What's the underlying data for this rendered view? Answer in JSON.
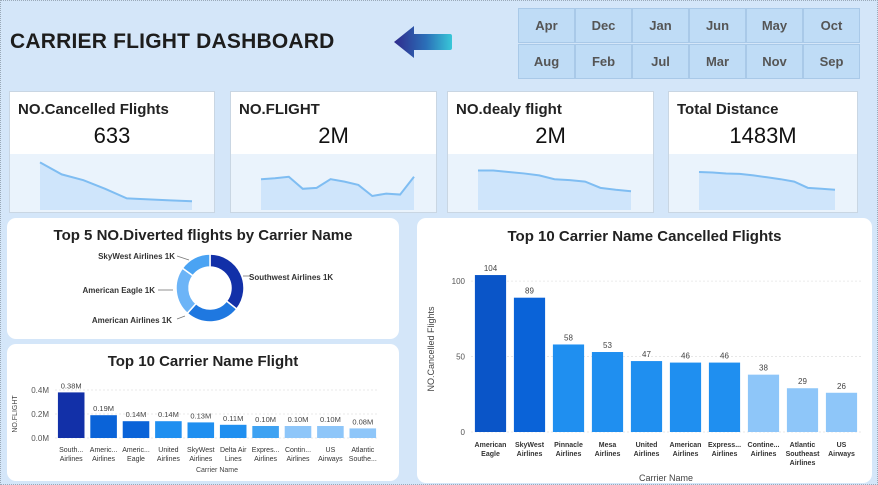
{
  "header": {
    "title": "CARRIER FLIGHT DASHBOARD"
  },
  "months": [
    "Apr",
    "Dec",
    "Jan",
    "Jun",
    "May",
    "Oct",
    "Aug",
    "Feb",
    "Jul",
    "Mar",
    "Nov",
    "Sep"
  ],
  "kpis": [
    {
      "label": "NO.Cancelled Flights",
      "value": "633",
      "trend": [
        95,
        70,
        58,
        40,
        20,
        18,
        16,
        14
      ]
    },
    {
      "label": "NO.FLIGHT",
      "value": "2M",
      "trend": [
        60,
        62,
        65,
        40,
        42,
        60,
        55,
        48,
        25,
        30,
        28,
        65
      ]
    },
    {
      "label": "NO.dealy flight",
      "value": "2M",
      "trend": [
        78,
        78,
        75,
        72,
        68,
        60,
        58,
        55,
        42,
        38,
        35
      ]
    },
    {
      "label": "Total Distance",
      "value": "1483M",
      "trend": [
        75,
        74,
        72,
        71,
        68,
        64,
        60,
        55,
        42,
        40,
        38
      ]
    }
  ],
  "colors": {
    "dark": "#1230a8",
    "mid": "#0a63d8",
    "bright": "#1f8ff0",
    "light": "#6cb4f7",
    "pale": "#8ec6f9"
  },
  "chart_data": [
    {
      "type": "pie",
      "title": "Top 5 NO.Diverted flights by Carrier Name",
      "slices": [
        {
          "label": "Southwest Airlines 1K",
          "value": 1.3,
          "color": "#1230a8"
        },
        {
          "label": "American Airlines 1K",
          "value": 0.95,
          "color": "#1f78e0"
        },
        {
          "label": "American Eagle 1K",
          "value": 0.85,
          "color": "#6cb4f7"
        },
        {
          "label": "SkyWest Airlines 1K",
          "value": 0.55,
          "color": "#4aa3f3"
        }
      ]
    },
    {
      "type": "bar",
      "title": "Top 10 Carrier Name Flight",
      "xlabel": "Carrier Name",
      "ylabel": "NO.FLIGHT",
      "ylim": [
        0,
        0.4
      ],
      "yticks": [
        "0.0M",
        "0.2M",
        "0.4M"
      ],
      "categories": [
        [
          "South...",
          "Airlines"
        ],
        [
          "Americ...",
          "Airlines"
        ],
        [
          "Americ...",
          "Eagle"
        ],
        [
          "United",
          "Airlines"
        ],
        [
          "SkyWest",
          "Airlines"
        ],
        [
          "Delta Air",
          "Lines"
        ],
        [
          "Expres...",
          "Airlines"
        ],
        [
          "Contin...",
          "Airlines"
        ],
        [
          "US",
          "Airways"
        ],
        [
          "Atlantic",
          "Southe..."
        ]
      ],
      "values": [
        0.38,
        0.19,
        0.14,
        0.14,
        0.13,
        0.11,
        0.1,
        0.1,
        0.1,
        0.08
      ],
      "labels": [
        "0.38M",
        "0.19M",
        "0.14M",
        "0.14M",
        "0.13M",
        "0.11M",
        "0.10M",
        "0.10M",
        "0.10M",
        "0.08M"
      ],
      "colors": [
        "#1230a8",
        "#0a63d8",
        "#0a63d8",
        "#1f8ff0",
        "#1f8ff0",
        "#1f8ff0",
        "#3ea2f2",
        "#8ec6f9",
        "#8ec6f9",
        "#8ec6f9"
      ]
    },
    {
      "type": "bar",
      "title": "Top 10 Carrier Name Cancelled Flights",
      "xlabel": "Carrier Name",
      "ylabel": "NO.Cancelled Flights",
      "ylim": [
        0,
        110
      ],
      "yticks": [
        "0",
        "50",
        "100"
      ],
      "categories": [
        [
          "American",
          "Eagle"
        ],
        [
          "SkyWest",
          "Airlines"
        ],
        [
          "Pinnacle",
          "Airlines"
        ],
        [
          "Mesa",
          "Airlines"
        ],
        [
          "United",
          "Airlines"
        ],
        [
          "American",
          "Airlines"
        ],
        [
          "Express...",
          "Airlines"
        ],
        [
          "Contine...",
          "Airlines"
        ],
        [
          "Atlantic",
          "Southeast",
          "Airlines"
        ],
        [
          "US",
          "Airways"
        ]
      ],
      "values": [
        104,
        89,
        58,
        53,
        47,
        46,
        46,
        38,
        29,
        26
      ],
      "labels": [
        "104",
        "89",
        "58",
        "53",
        "47",
        "46",
        "46",
        "38",
        "29",
        "26"
      ],
      "colors": [
        "#0a55c8",
        "#0a63d8",
        "#1f8ff0",
        "#1f8ff0",
        "#1f8ff0",
        "#1f8ff0",
        "#1f8ff0",
        "#8ec6f9",
        "#8ec6f9",
        "#8ec6f9"
      ]
    }
  ]
}
